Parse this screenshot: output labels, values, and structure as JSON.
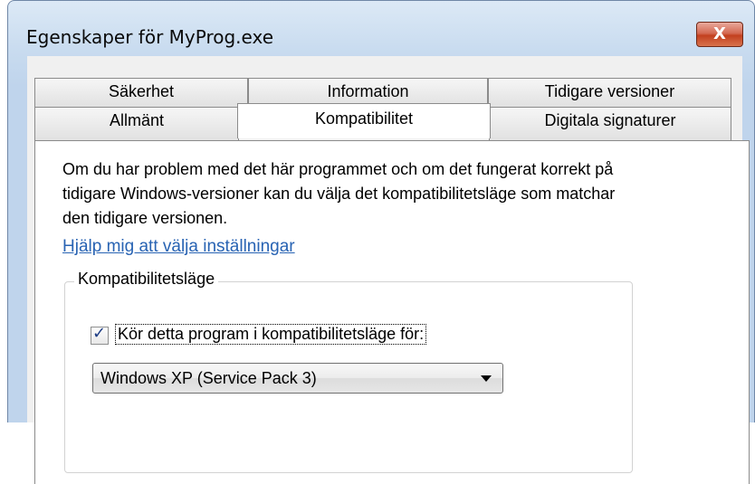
{
  "window": {
    "title": "Egenskaper för MyProg.exe",
    "close_label": "X"
  },
  "tabs": {
    "row1": [
      "Säkerhet",
      "Information",
      "Tidigare versioner"
    ],
    "row2": [
      "Allmänt",
      "Kompatibilitet",
      "Digitala signaturer"
    ],
    "active": "Kompatibilitet"
  },
  "content": {
    "description": "Om du har problem med det här programmet och om det fungerat korrekt på tidigare Windows-versioner kan du välja det kompatibilitetsläge som matchar den tidigare versionen.",
    "help_link": "Hjälp mig att välja inställningar",
    "group_title": "Kompatibilitetsläge",
    "checkbox_label": "Kör detta program i kompatibilitetsläge för:",
    "checkbox_checked": true,
    "checkmark": "✓",
    "select_value": "Windows XP (Service Pack 3)"
  },
  "colors": {
    "link": "#2863b3",
    "titlebar": "#c8dbef",
    "close": "#c2401f"
  }
}
